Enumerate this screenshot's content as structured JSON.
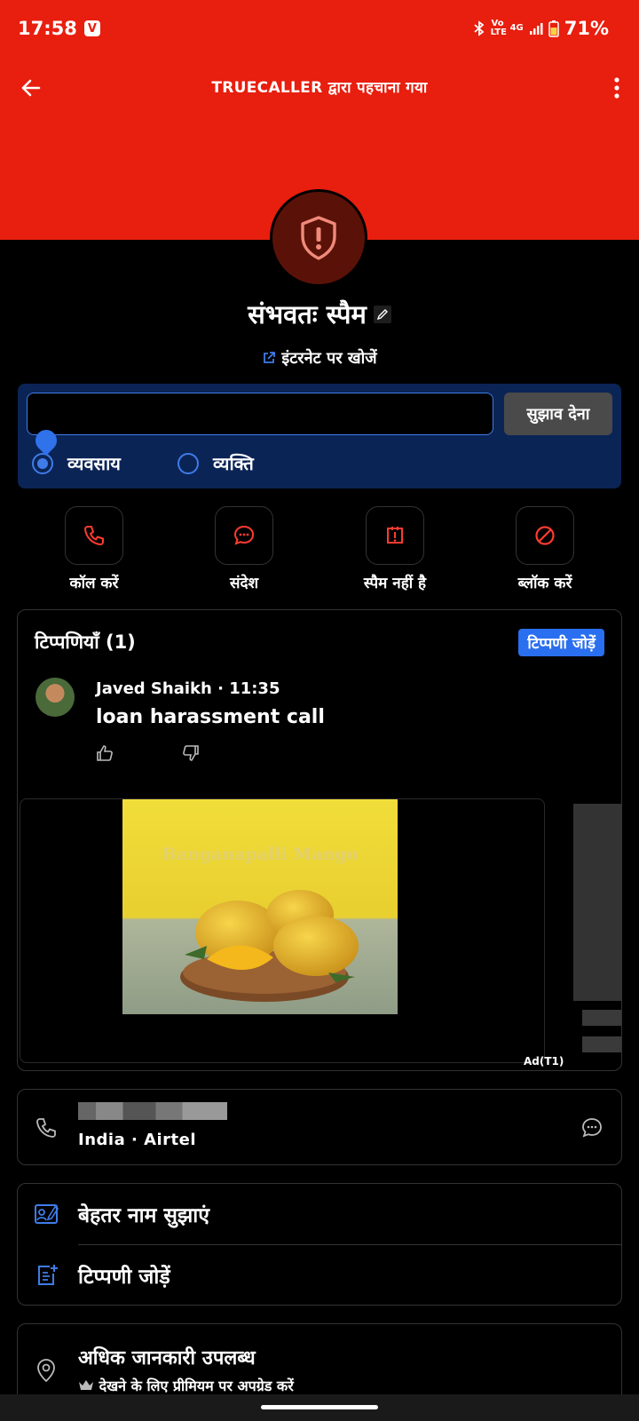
{
  "status_bar": {
    "time": "17:58",
    "notification_badge": "V",
    "network_small": "Vo LTE",
    "network_type": "4G",
    "battery": "71%"
  },
  "app_bar": {
    "title": "TRUECALLER द्वारा पहचाना गया",
    "back_icon": "arrow-left-icon",
    "menu_icon": "kebab-menu-icon"
  },
  "profile": {
    "avatar_icon": "shield-exclamation-icon",
    "name": "संभवतः स्पैम",
    "search_link": "इंटरनेट पर खोजें"
  },
  "suggest": {
    "input_value": "",
    "button_label": "सुझाव देना",
    "options": [
      {
        "label": "व्यवसाय",
        "selected": true
      },
      {
        "label": "व्यक्ति",
        "selected": false
      }
    ]
  },
  "actions": [
    {
      "label": "कॉल करें",
      "icon": "phone-icon"
    },
    {
      "label": "संदेश",
      "icon": "message-icon"
    },
    {
      "label": "स्पैम नहीं है",
      "icon": "not-spam-icon"
    },
    {
      "label": "ब्लॉक करें",
      "icon": "block-icon"
    }
  ],
  "comments": {
    "title": "टिप्पणियाँ (1)",
    "add_button": "टिप्पणी जोड़ें",
    "items": [
      {
        "author_time": "Javed Shaikh · 11:35",
        "text": "loan harassment call"
      }
    ]
  },
  "ad": {
    "image_caption": "Banganapalli Mango",
    "label": "Ad(T1)"
  },
  "number_card": {
    "carrier": "India · Airtel"
  },
  "options": [
    {
      "label": "बेहतर नाम सुझाएं",
      "icon": "edit-name-icon"
    },
    {
      "label": "टिप्पणी जोड़ें",
      "icon": "add-note-icon"
    }
  ],
  "more_info": {
    "title": "अधिक जानकारी उपलब्ध",
    "subtitle": "देखने के लिए प्रीमियम पर अपग्रेड करें",
    "crown_icon": "crown-icon",
    "location_icon": "location-pin-icon"
  },
  "colors": {
    "header_red": "#e81e0e",
    "accent_blue": "#2a6ff0",
    "suggest_bg": "#0b2456"
  }
}
